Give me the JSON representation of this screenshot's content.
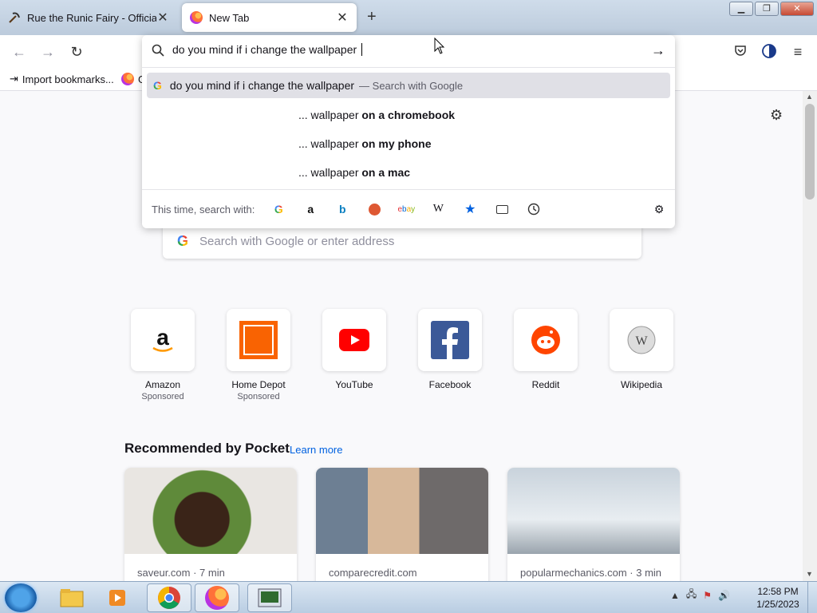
{
  "tabs": [
    {
      "title": "Rue the Runic Fairy - Official Pi",
      "icon": "pickaxe-icon",
      "active": false
    },
    {
      "title": "New Tab",
      "icon": "firefox-icon",
      "active": true
    }
  ],
  "nav": {
    "back_icon": "arrow-left-icon",
    "forward_icon": "arrow-right-icon",
    "reload_icon": "reload-icon"
  },
  "urlbar": {
    "value": "do you mind if i change the wallpaper ",
    "suggestions": [
      {
        "text": "do you mind if i change the wallpaper",
        "sub": "— Search with Google",
        "highlighted": true,
        "prefix": "",
        "bold": ""
      },
      {
        "text": "",
        "prefix": "... wallpaper ",
        "bold": "on a chromebook",
        "highlighted": false
      },
      {
        "text": "",
        "prefix": "... wallpaper ",
        "bold": "on my phone",
        "highlighted": false
      },
      {
        "text": "",
        "prefix": "... wallpaper ",
        "bold": "on a mac",
        "highlighted": false
      }
    ],
    "one_offs_label": "This time, search with:",
    "engines": [
      "google",
      "amazon",
      "bing",
      "duckduckgo",
      "ebay",
      "wikipedia",
      "bookmarks",
      "tabs",
      "history"
    ]
  },
  "bookmarks": [
    {
      "label": "Import bookmarks...",
      "icon": "import-icon"
    },
    {
      "label": "G",
      "icon": "firefox-icon"
    }
  ],
  "content": {
    "search_placeholder": "Search with Google or enter address",
    "top_sites": [
      {
        "name": "Amazon",
        "sub": "Sponsored",
        "icon": "amazon-icon"
      },
      {
        "name": "Home Depot",
        "sub": "Sponsored",
        "icon": "home-depot-icon"
      },
      {
        "name": "YouTube",
        "sub": "",
        "icon": "youtube-icon"
      },
      {
        "name": "Facebook",
        "sub": "",
        "icon": "facebook-icon"
      },
      {
        "name": "Reddit",
        "sub": "",
        "icon": "reddit-icon"
      },
      {
        "name": "Wikipedia",
        "sub": "",
        "icon": "wikipedia-icon"
      }
    ],
    "pocket": {
      "heading": "Recommended by Pocket",
      "learn_more": "Learn more",
      "cards": [
        {
          "source": "saveur.com · 7 min"
        },
        {
          "source": "comparecredit.com"
        },
        {
          "source": "popularmechanics.com · 3 min"
        }
      ]
    }
  },
  "taskbar": {
    "time": "12:58 PM",
    "date": "1/25/2023"
  },
  "colors": {
    "accent": "#0061e0",
    "firefox_orange": "#ff7139",
    "highlight_row": "#e0e0e6"
  }
}
